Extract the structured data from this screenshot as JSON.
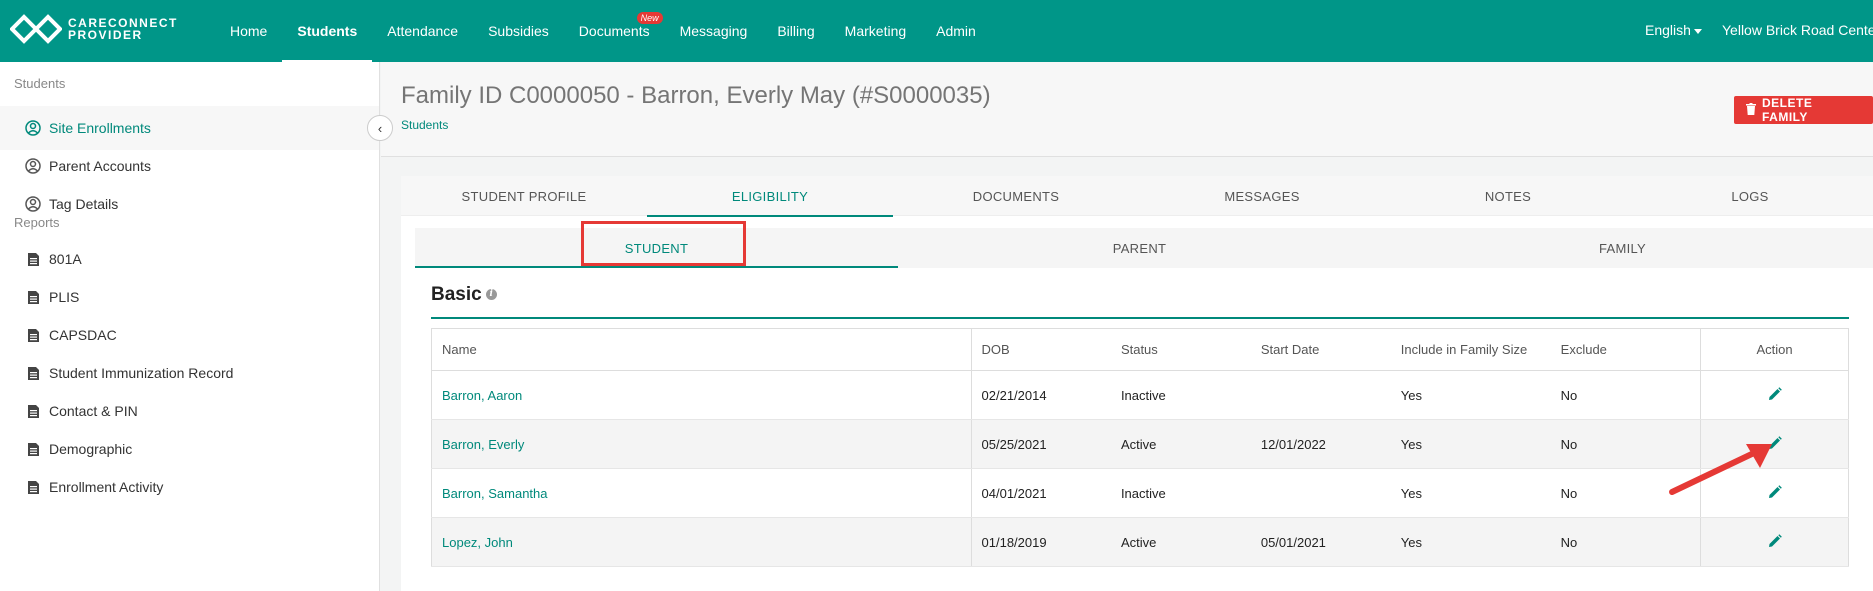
{
  "brand": {
    "line1": "CARECONNECT",
    "line2": "PROVIDER"
  },
  "nav": {
    "items": [
      "Home",
      "Students",
      "Attendance",
      "Subsidies",
      "Documents",
      "Messaging",
      "Billing",
      "Marketing",
      "Admin"
    ],
    "active": "Students",
    "new_badge": "New",
    "language": "English",
    "center": "Yellow Brick Road Center"
  },
  "sidebar": {
    "section_students": "Students",
    "students_items": [
      "Site Enrollments",
      "Parent Accounts",
      "Tag Details"
    ],
    "section_reports": "Reports",
    "reports_items": [
      "801A",
      "PLIS",
      "CAPSDAC",
      "Student Immunization Record",
      "Contact & PIN",
      "Demographic",
      "Enrollment Activity"
    ],
    "collapse_glyph": "‹"
  },
  "page": {
    "title": "Family ID C0000050 - Barron, Everly May (#S0000035)",
    "breadcrumb": "Students",
    "delete_label": "DELETE FAMILY"
  },
  "tabs": [
    "STUDENT PROFILE",
    "ELIGIBILITY",
    "DOCUMENTS",
    "MESSAGES",
    "NOTES",
    "LOGS"
  ],
  "active_tab": "ELIGIBILITY",
  "subtabs": [
    "STUDENT",
    "PARENT",
    "FAMILY"
  ],
  "active_subtab": "STUDENT",
  "section": {
    "title": "Basic",
    "info_glyph": "i"
  },
  "table": {
    "headers": [
      "Name",
      "DOB",
      "Status",
      "Start Date",
      "Include in Family Size",
      "Exclude",
      "Action"
    ],
    "rows": [
      {
        "name": "Barron, Aaron",
        "dob": "02/21/2014",
        "status": "Inactive",
        "start": "",
        "include": "Yes",
        "exclude": "No"
      },
      {
        "name": "Barron, Everly",
        "dob": "05/25/2021",
        "status": "Active",
        "start": "12/01/2022",
        "include": "Yes",
        "exclude": "No"
      },
      {
        "name": "Barron, Samantha",
        "dob": "04/01/2021",
        "status": "Inactive",
        "start": "",
        "include": "Yes",
        "exclude": "No"
      },
      {
        "name": "Lopez, John",
        "dob": "01/18/2019",
        "status": "Active",
        "start": "05/01/2021",
        "include": "Yes",
        "exclude": "No"
      }
    ]
  },
  "colors": {
    "primary": "#009688",
    "accent_text": "#00897b",
    "danger": "#e53935"
  }
}
